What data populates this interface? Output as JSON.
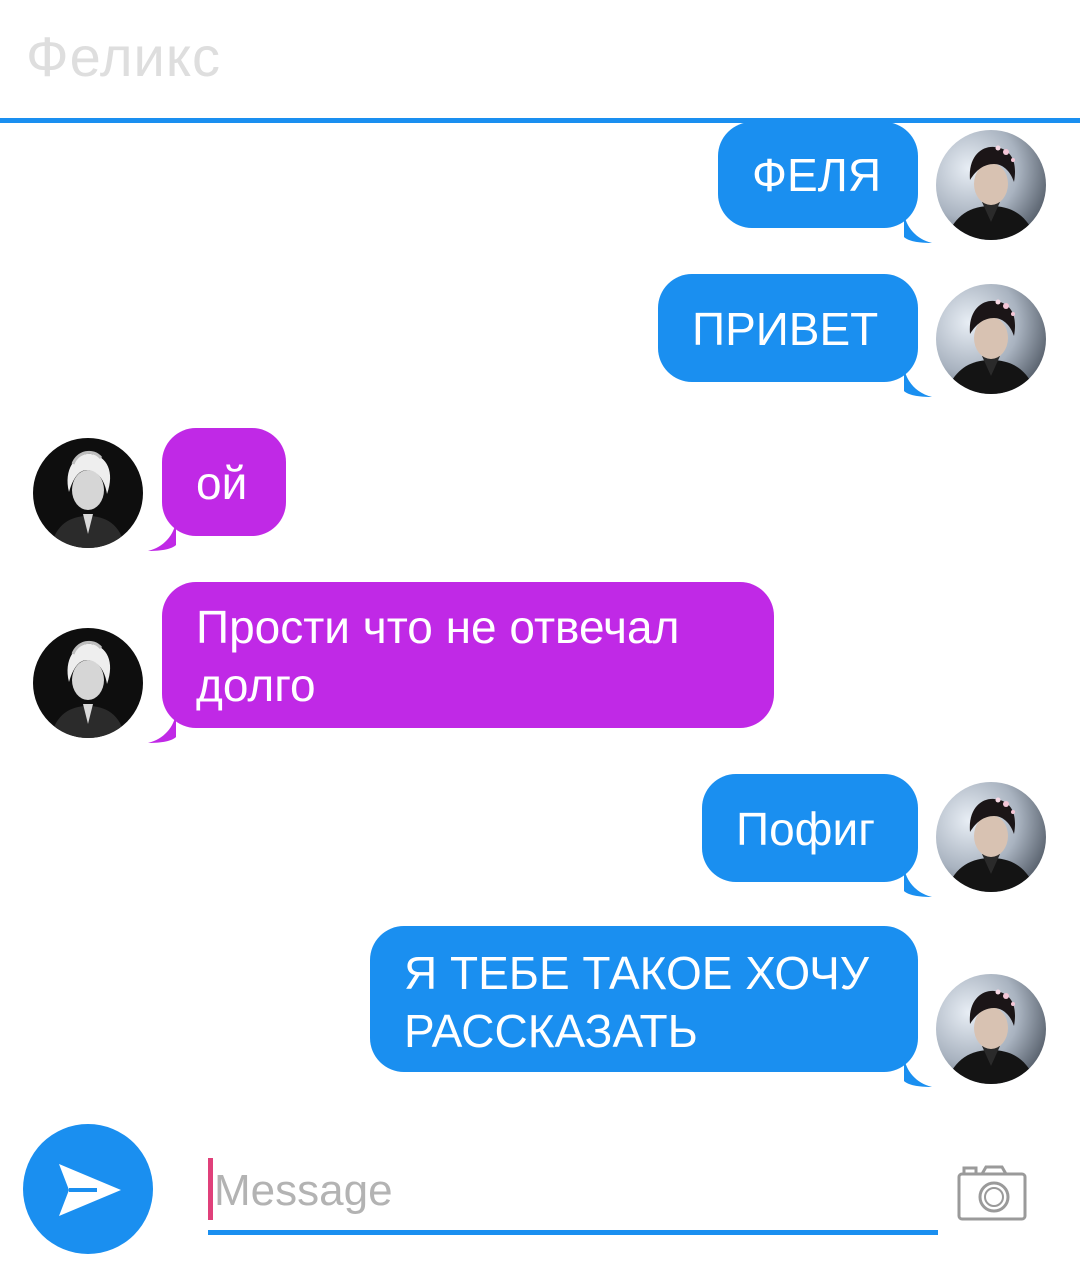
{
  "app": {
    "contact_name": "Феликс"
  },
  "colors": {
    "accent": "#1a8ff0",
    "outgoing": "#1a8ff0",
    "incoming": "#c029e6",
    "header_text": "#dedede",
    "placeholder": "#b3b3b3",
    "cursor": "#e0407a"
  },
  "messages": [
    {
      "side": "outgoing",
      "text": "ФЕЛЯ",
      "avatar": "user-avatar-icon"
    },
    {
      "side": "outgoing",
      "text": "ПРИВЕТ",
      "avatar": "user-avatar-icon"
    },
    {
      "side": "incoming",
      "text": "ой",
      "avatar": "contact-avatar-icon"
    },
    {
      "side": "incoming",
      "text": "Прости что не отвечал долго",
      "avatar": "contact-avatar-icon"
    },
    {
      "side": "outgoing",
      "text": "Пофиг",
      "avatar": "user-avatar-icon"
    },
    {
      "side": "outgoing",
      "text": "Я ТЕБЕ ТАКОЕ ХОЧУ РАССКАЗАТЬ",
      "avatar": "user-avatar-icon"
    }
  ],
  "composer": {
    "placeholder": "Message",
    "value": "",
    "send_icon": "send-icon",
    "camera_icon": "camera-icon"
  }
}
